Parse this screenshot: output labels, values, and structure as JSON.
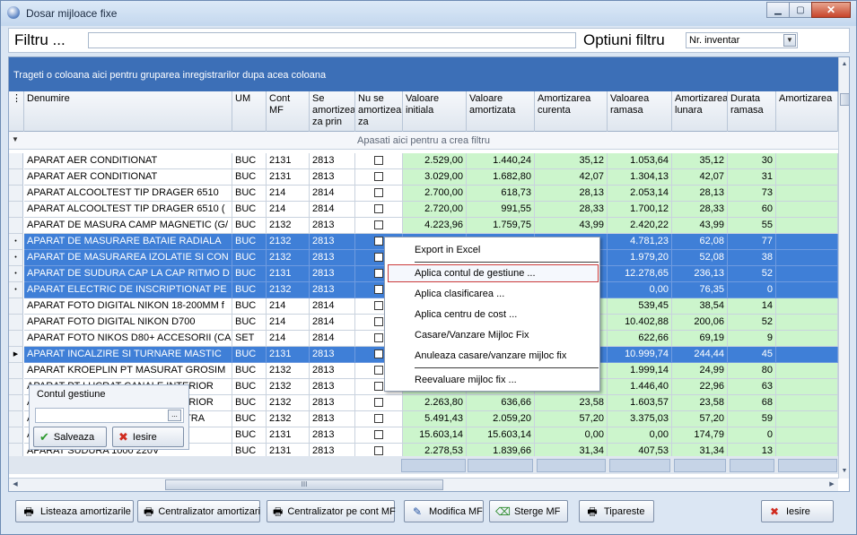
{
  "window": {
    "title": "Dosar mijloace fixe",
    "min": "▁",
    "max": "▢",
    "close": "✕"
  },
  "filter": {
    "label": "Filtru ...",
    "value": "",
    "options_label": "Optiuni filtru",
    "options_selected": "Nr. inventar"
  },
  "grid": {
    "group_hint": "Trageti o coloana aici pentru gruparea inregistrarilor dupa acea coloana",
    "filter_row_text": "Apasati aici pentru a  crea filtru",
    "columns": [
      "Denumire",
      "UM",
      "Cont MF",
      "Se amortizea za prin ...",
      "Nu se amortizea za",
      "Valoare initiala",
      "Valoare amortizata",
      "Amortizarea curenta",
      "Valoarea ramasa",
      "Amortizarea lunara",
      "Durata ramasa",
      "Amortizarea"
    ],
    "rows": [
      {
        "den": "APARAT AER CONDITIONAT",
        "um": "BUC",
        "cont": "2131",
        "prin": "2813",
        "vi": "2.529,00",
        "va": "1.440,24",
        "ac": "35,12",
        "vr": "1.053,64",
        "al": "35,12",
        "dr": "30",
        "sel": false,
        "ind": ""
      },
      {
        "den": "APARAT AER CONDITIONAT",
        "um": "BUC",
        "cont": "2131",
        "prin": "2813",
        "vi": "3.029,00",
        "va": "1.682,80",
        "ac": "42,07",
        "vr": "1.304,13",
        "al": "42,07",
        "dr": "31",
        "sel": false,
        "ind": ""
      },
      {
        "den": "APARAT ALCOOLTEST TIP DRAGER 6510",
        "um": "BUC",
        "cont": "214",
        "prin": "2814",
        "vi": "2.700,00",
        "va": "618,73",
        "ac": "28,13",
        "vr": "2.053,14",
        "al": "28,13",
        "dr": "73",
        "sel": false,
        "ind": ""
      },
      {
        "den": "APARAT ALCOOLTEST TIP DRAGER 6510 (",
        "um": "BUC",
        "cont": "214",
        "prin": "2814",
        "vi": "2.720,00",
        "va": "991,55",
        "ac": "28,33",
        "vr": "1.700,12",
        "al": "28,33",
        "dr": "60",
        "sel": false,
        "ind": ""
      },
      {
        "den": "APARAT DE MASURA CAMP MAGNETIC (G/",
        "um": "BUC",
        "cont": "2132",
        "prin": "2813",
        "vi": "4.223,96",
        "va": "1.759,75",
        "ac": "43,99",
        "vr": "2.420,22",
        "al": "43,99",
        "dr": "55",
        "sel": false,
        "ind": ""
      },
      {
        "den": "APARAT DE MASURARE BATAIE RADIALA",
        "um": "BUC",
        "cont": "2132",
        "prin": "2813",
        "vi": "",
        "va": "",
        "ac": "",
        "vr": "4.781,23",
        "al": "62,08",
        "dr": "77",
        "sel": true,
        "ind": "•"
      },
      {
        "den": "APARAT DE MASURAREA IZOLATIE SI CON",
        "um": "BUC",
        "cont": "2132",
        "prin": "2813",
        "vi": "",
        "va": "",
        "ac": "",
        "vr": "1.979,20",
        "al": "52,08",
        "dr": "38",
        "sel": true,
        "ind": "•"
      },
      {
        "den": "APARAT DE SUDURA CAP LA CAP RITMO D",
        "um": "BUC",
        "cont": "2131",
        "prin": "2813",
        "vi": "",
        "va": "",
        "ac": "",
        "vr": "12.278,65",
        "al": "236,13",
        "dr": "52",
        "sel": true,
        "ind": "•"
      },
      {
        "den": "APARAT ELECTRIC DE INSCRIPTIONAT PE",
        "um": "BUC",
        "cont": "2132",
        "prin": "2813",
        "vi": "",
        "va": "",
        "ac": "",
        "vr": "0,00",
        "al": "76,35",
        "dr": "0",
        "sel": true,
        "ind": "•"
      },
      {
        "den": "APARAT FOTO DIGITAL NIKON 18-200MM f",
        "um": "BUC",
        "cont": "214",
        "prin": "2814",
        "vi": "",
        "va": "",
        "ac": "",
        "vr": "539,45",
        "al": "38,54",
        "dr": "14",
        "sel": false,
        "ind": ""
      },
      {
        "den": "APARAT FOTO DIGITAL NIKON D700",
        "um": "BUC",
        "cont": "214",
        "prin": "2814",
        "vi": "",
        "va": "",
        "ac": "",
        "vr": "10.402,88",
        "al": "200,06",
        "dr": "52",
        "sel": false,
        "ind": ""
      },
      {
        "den": "APARAT FOTO NIKOS D80+ ACCESORII (CA",
        "um": "SET",
        "cont": "214",
        "prin": "2814",
        "vi": "",
        "va": "",
        "ac": "",
        "vr": "622,66",
        "al": "69,19",
        "dr": "9",
        "sel": false,
        "ind": ""
      },
      {
        "den": "APARAT INCALZIRE SI TURNARE MASTIC",
        "um": "BUC",
        "cont": "2131",
        "prin": "2813",
        "vi": "",
        "va": "",
        "ac": "",
        "vr": "10.999,74",
        "al": "244,44",
        "dr": "45",
        "sel": true,
        "ind": "▶"
      },
      {
        "den": "APARAT KROEPLIN PT MASURAT GROSIM",
        "um": "BUC",
        "cont": "2132",
        "prin": "2813",
        "vi": "",
        "va": "",
        "ac": "",
        "vr": "1.999,14",
        "al": "24,99",
        "dr": "80",
        "sel": false,
        "ind": ""
      },
      {
        "den": "APARAT PT LUCRAT CANALE INTERIOR",
        "um": "BUC",
        "cont": "2132",
        "prin": "2813",
        "vi": "",
        "va": "",
        "ac": "",
        "vr": "1.446,40",
        "al": "22,96",
        "dr": "63",
        "sel": false,
        "ind": ""
      },
      {
        "den": "APARAT PT LUCRAT CANALE INTERIOR",
        "um": "BUC",
        "cont": "2132",
        "prin": "2813",
        "vi": "2.263,80",
        "va": "636,66",
        "ac": "23,58",
        "vr": "1.603,57",
        "al": "23,58",
        "dr": "68",
        "sel": false,
        "ind": ""
      },
      {
        "den": "APARAT SUDURA CONDUCTE II STRA",
        "um": "BUC",
        "cont": "2132",
        "prin": "2813",
        "vi": "5.491,43",
        "va": "2.059,20",
        "ac": "57,20",
        "vr": "3.375,03",
        "al": "57,20",
        "dr": "59",
        "sel": false,
        "ind": ""
      },
      {
        "den": "APARAT SUDURA TIRAJ \"GEC",
        "um": "BUC",
        "cont": "2131",
        "prin": "2813",
        "vi": "15.603,14",
        "va": "15.603,14",
        "ac": "0,00",
        "vr": "0,00",
        "al": "174,79",
        "dr": "0",
        "sel": false,
        "ind": ""
      },
      {
        "den": "APARAT SUDURA 1000 220V",
        "um": "BUC",
        "cont": "2131",
        "prin": "2813",
        "vi": "2.278,53",
        "va": "1.839,66",
        "ac": "31,34",
        "vr": "407,53",
        "al": "31,34",
        "dr": "13",
        "sel": false,
        "ind": ""
      }
    ]
  },
  "context_menu": {
    "items": [
      "Export in Excel",
      "Aplica  contul de gestiune ...",
      "Aplica clasificarea ...",
      "Aplica centru de cost ...",
      "Casare/Vanzare Mijloc Fix",
      "Anuleaza casare/vanzare mijloc fix",
      "Reevaluare mijloc fix ..."
    ]
  },
  "popup": {
    "label": "Contul gestiune",
    "value": "",
    "dots": "...",
    "save": "Salveaza",
    "exit": "Iesire"
  },
  "buttons": {
    "list": "Listeaza amortizarile",
    "central": "Centralizator amortizari",
    "central_cont": "Centralizator pe cont MF",
    "modify": "Modifica MF",
    "delete": "Sterge MF",
    "print": "Tipareste",
    "exit": "Iesire"
  },
  "colors": {
    "selected": "#3f7fd7",
    "numeric_bg": "#ccf5cc",
    "group_bar": "#3c6fb7"
  }
}
